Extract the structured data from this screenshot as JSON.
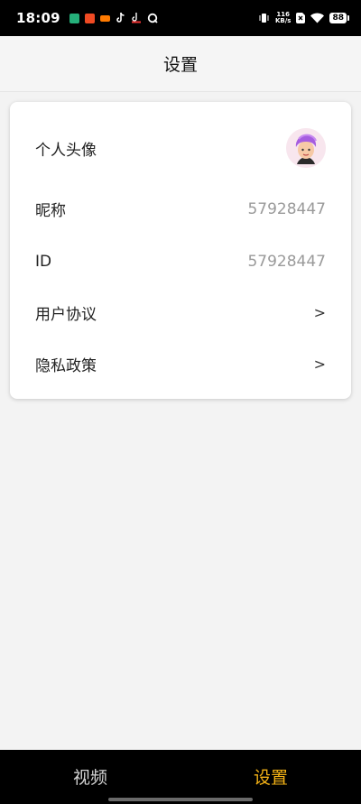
{
  "status_bar": {
    "time": "18:09",
    "net_speed_value": "116",
    "net_speed_unit": "KB/s",
    "battery": "88",
    "app_icons": [
      {
        "name": "app-green",
        "color": "#25b07a"
      },
      {
        "name": "app-orange",
        "color": "#f04a23"
      },
      {
        "name": "app-taobao",
        "color": "#ff7a00"
      },
      {
        "name": "app-tiktok",
        "color": "#ffffff"
      },
      {
        "name": "app-tiktok-lite",
        "color": "#ffffff"
      },
      {
        "name": "app-q",
        "color": "#ffffff"
      }
    ]
  },
  "header": {
    "title": "设置"
  },
  "settings": {
    "avatar_label": "个人头像",
    "nickname_label": "昵称",
    "nickname_value": "57928447",
    "id_label": "ID",
    "id_value": "57928447",
    "user_agreement_label": "用户协议",
    "privacy_policy_label": "隐私政策",
    "chevron": ">"
  },
  "tabs": [
    {
      "label": "视频",
      "active": false
    },
    {
      "label": "设置",
      "active": true
    }
  ],
  "colors": {
    "accent": "#f5b316",
    "page_bg": "#f3f3f3",
    "bar_bg": "#000000"
  }
}
